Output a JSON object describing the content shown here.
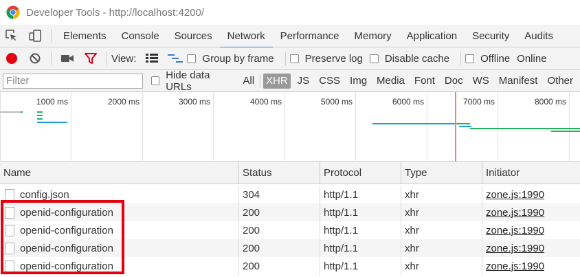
{
  "window": {
    "title": "Developer Tools - http://localhost:4200/"
  },
  "tabs": [
    "Elements",
    "Console",
    "Sources",
    "Network",
    "Performance",
    "Memory",
    "Application",
    "Security",
    "Audits"
  ],
  "active_tab": "Network",
  "toolbar": {
    "view_label": "View:",
    "group_by_frame": "Group by frame",
    "preserve_log": "Preserve log",
    "disable_cache": "Disable cache",
    "offline": "Offline",
    "online": "Online"
  },
  "filter": {
    "placeholder": "Filter",
    "hide_data_urls": "Hide data URLs",
    "types": [
      "All",
      "XHR",
      "JS",
      "CSS",
      "Img",
      "Media",
      "Font",
      "Doc",
      "WS",
      "Manifest",
      "Other"
    ],
    "active_type": "XHR"
  },
  "overview": {
    "ticks": [
      "1000 ms",
      "2000 ms",
      "3000 ms",
      "4000 ms",
      "5000 ms",
      "6000 ms",
      "7000 ms",
      "8000 ms"
    ]
  },
  "table": {
    "columns": [
      "Name",
      "Status",
      "Protocol",
      "Type",
      "Initiator"
    ],
    "rows": [
      {
        "name": "config.json",
        "status": "304",
        "protocol": "http/1.1",
        "type": "xhr",
        "initiator": "zone.js:1990"
      },
      {
        "name": "openid-configuration",
        "status": "200",
        "protocol": "http/1.1",
        "type": "xhr",
        "initiator": "zone.js:1990"
      },
      {
        "name": "openid-configuration",
        "status": "200",
        "protocol": "http/1.1",
        "type": "xhr",
        "initiator": "zone.js:1990"
      },
      {
        "name": "openid-configuration",
        "status": "200",
        "protocol": "http/1.1",
        "type": "xhr",
        "initiator": "zone.js:1990"
      },
      {
        "name": "openid-configuration",
        "status": "200",
        "protocol": "http/1.1",
        "type": "xhr",
        "initiator": "zone.js:1990"
      }
    ]
  },
  "colors": {
    "accent": "#3879d9",
    "record": "#e3000f",
    "filter_icon": "#e3000f",
    "highlight": "#e3000f",
    "waiting_bar": "#1a9dd9",
    "download_bar": "#1fb35a",
    "load_line": "#f18080"
  }
}
